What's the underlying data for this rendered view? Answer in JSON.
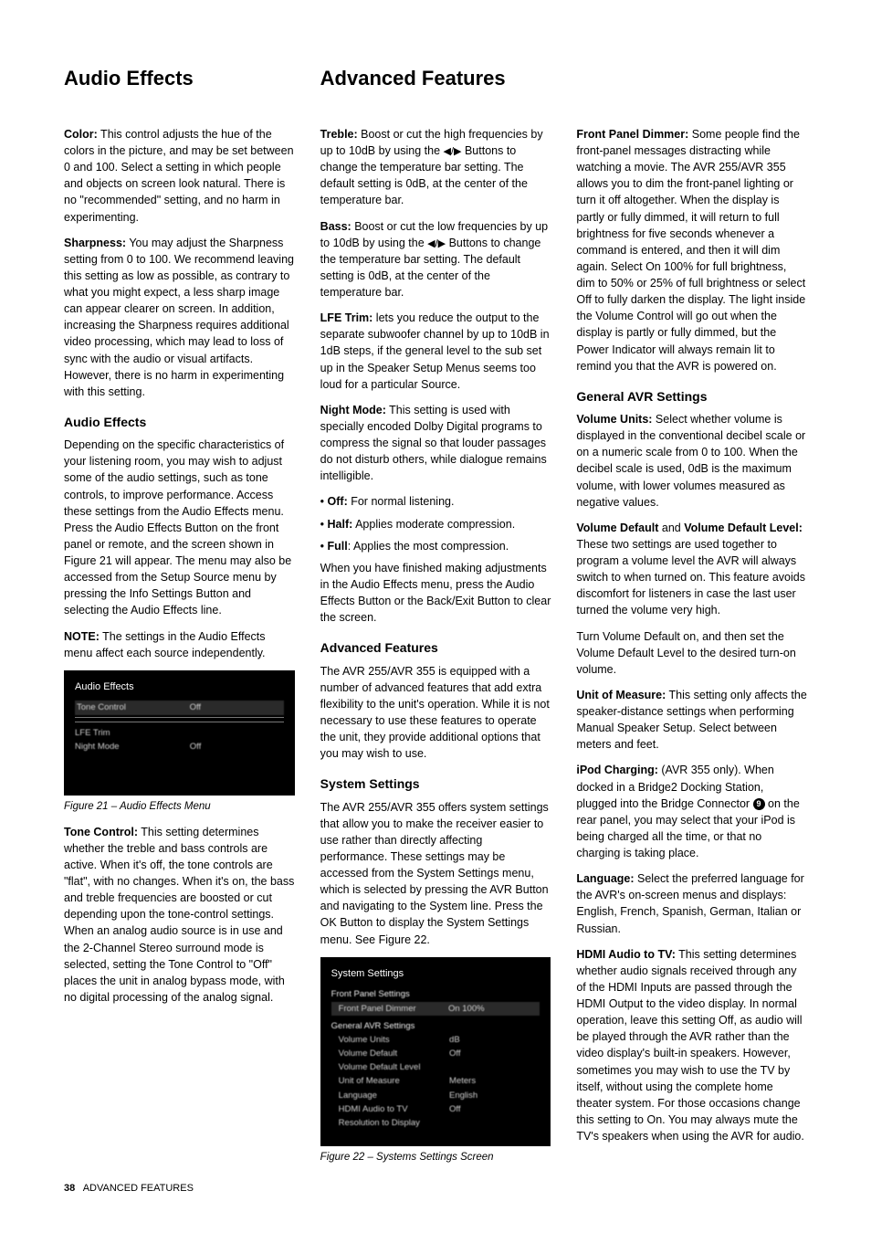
{
  "headings": {
    "left": "Audio Effects",
    "mid": "Advanced Features",
    "right": ""
  },
  "col1": {
    "p1a": "Color:",
    "p1b": " This control adjusts the hue of the colors in the picture, and may be set between 0 and 100. Select a setting in which people and objects on screen look natural. There is no \"recommended\" setting, and no harm in experimenting.",
    "p2a": "Sharpness:",
    "p2b": " You may adjust the Sharpness setting from 0 to 100. We recommend leaving this setting as low as possible, as contrary to what you might expect, a less sharp image can appear clearer on screen. In addition, increasing the Sharpness requires additional video processing, which may lead to loss of sync with the audio or visual artifacts. However, there is no harm in experimenting with this setting.",
    "h2": "Audio Effects",
    "p3": "Depending on the specific characteristics of your listening room, you may wish to adjust some of the audio settings, such as tone controls, to improve performance. Access these settings from the Audio Effects menu. Press the Audio Effects Button on the front panel or remote, and the screen shown in Figure 21 will appear. The menu may also be accessed from the Setup Source menu by pressing the Info Settings Button and selecting the Audio Effects line.",
    "p4a": "NOTE:",
    "p4b": " The settings in the Audio Effects menu affect each source independently.",
    "fig21": {
      "title": "Audio Effects",
      "rows": [
        {
          "k": "Tone Control",
          "v": "Off"
        },
        {
          "hr": true
        },
        {
          "hr": true
        },
        {
          "k": "LFE Trim",
          "v": ""
        },
        {
          "k": "Night Mode",
          "v": "Off"
        }
      ]
    },
    "cap21": "Figure 21 – Audio Effects Menu",
    "p5a": "Tone Control:",
    "p5b": " This setting determines whether the treble and bass controls are active. When it's off, the tone controls are \"flat\", with no changes. When it's on, the bass and treble frequencies are boosted or cut depending upon the tone-control settings. When an analog audio source is in use and the 2-Channel Stereo surround mode is selected, setting the Tone Control to \"Off\" places the unit in analog bypass mode, with no digital processing of the analog signal."
  },
  "col2": {
    "p1a": "Treble:",
    "p1b_pre": " Boost or cut the high frequencies by up to 10dB by using the ",
    "p1b_post": " Buttons to change the temperature bar setting. The default setting is 0dB, at the center of the temperature bar.",
    "p2a": "Bass:",
    "p2b_pre": " Boost or cut the low frequencies by up to 10dB by using the ",
    "p2b_post": " Buttons to change the temperature bar setting. The default setting is 0dB, at the center of the temperature bar.",
    "p3a": "LFE Trim:",
    "p3b": " lets you reduce the output to the separate subwoofer channel by up to 10dB in 1dB steps, if the general level  to the sub set up in the Speaker Setup Menus seems too loud for a particular Source.",
    "p4a": "Night Mode:",
    "p4b": " This setting is used with specially encoded Dolby Digital programs to compress the signal so that louder passages do not disturb others, while dialogue remains intelligible.",
    "b1a": "Off:",
    "b1b": " For normal listening.",
    "b2a": "Half:",
    "b2b": " Applies moderate compression.",
    "b3a": "Full",
    "b3b": ": Applies the most compression.",
    "p5": "When you have finished making adjustments in the Audio Effects menu, press the Audio Effects Button or the Back/Exit Button to clear the screen.",
    "h2a": "Advanced Features",
    "p6": "The AVR 255/AVR 355 is equipped with a number of advanced features that add extra flexibility to the unit's operation. While it is not necessary to use these features to operate the unit, they provide additional options that you may wish to use.",
    "h2b": "System Settings",
    "p7": "The AVR 255/AVR 355 offers system settings that allow you to make the receiver easier to use rather than directly affecting performance. These settings may be accessed from the System Settings menu, which is selected by pressing the AVR Button and navigating to the System line. Press the OK Button to display the System Settings menu. See Figure 22.",
    "fig22": {
      "title": "System Settings",
      "sub1": "Front Panel Settings",
      "rows1": [
        {
          "k": "Front Panel Dimmer",
          "v": "On 100%",
          "hl": true
        }
      ],
      "sub2": "General AVR Settings",
      "rows2": [
        {
          "k": "Volume Units",
          "v": "dB"
        },
        {
          "k": "Volume Default",
          "v": "Off"
        },
        {
          "k": "Volume Default Level",
          "v": ""
        },
        {
          "k": "Unit of Measure",
          "v": "Meters"
        },
        {
          "k": "Language",
          "v": "English"
        },
        {
          "k": "HDMI Audio to TV",
          "v": "Off"
        },
        {
          "k": "Resolution to Display",
          "v": ""
        }
      ]
    },
    "cap22": "Figure 22 – Systems Settings Screen"
  },
  "col3": {
    "p1a": "Front Panel Dimmer:",
    "p1b": " Some people find the front-panel messages distracting while watching a movie. The AVR 255/AVR 355 allows you to dim the front-panel lighting or turn it off altogether. When the display is partly or fully dimmed, it will return to full brightness for five seconds whenever a command is entered, and then it will dim again. Select On 100% for full brightness, dim to 50% or 25% of full brightness or select Off to fully darken the display. The light inside the Volume Control will go out when the display is partly or fully dimmed, but the Power Indicator will always remain lit to remind you that the AVR is powered on.",
    "h2": "General AVR Settings",
    "p2a": "Volume Units:",
    "p2b": " Select whether volume is displayed in the conventional decibel scale or on a numeric scale from 0 to 100. When the decibel scale is used, 0dB is the maximum volume, with lower volumes measured as negative values.",
    "p3a": "Volume Default",
    "p3mid": " and ",
    "p3b": "Volume Default Level:",
    "p3c": " These two settings are used together to program a volume level the AVR will always switch to when turned on. This feature avoids discomfort for listeners in case the last user turned the volume very high.",
    "p4": "Turn Volume Default on, and then set the Volume Default Level to the desired turn-on volume.",
    "p5a": "Unit of Measure:",
    "p5b": " This setting only affects the speaker-distance settings when performing Manual Speaker Setup. Select between meters and feet.",
    "p6a": "iPod Charging:",
    "p6b_pre": " (AVR 355 only). When docked in a Bridge2 Docking Station, plugged into the Bridge Connector ",
    "p6b_post": " on the rear panel, you may select that your iPod is being charged all the time, or that no charging is taking place.",
    "circled": "9",
    "p7a": "Language:",
    "p7b": " Select the preferred language for the AVR's on-screen menus and displays: English, French, Spanish, German, Italian or Russian.",
    "p8a": "HDMI Audio to TV:",
    "p8b": " This setting determines whether audio signals received through any of the HDMI Inputs are passed through the HDMI Output to the video display. In normal operation, leave this setting Off, as audio will be played through the AVR rather than the video display's built-in speakers. However, sometimes you may wish to use the TV by itself, without using the complete home theater system. For those occasions change this setting to On. You may always mute the TV's speakers when using the AVR for audio."
  },
  "footer": {
    "page": "38",
    "label": "ADVANCED FEATURES"
  }
}
